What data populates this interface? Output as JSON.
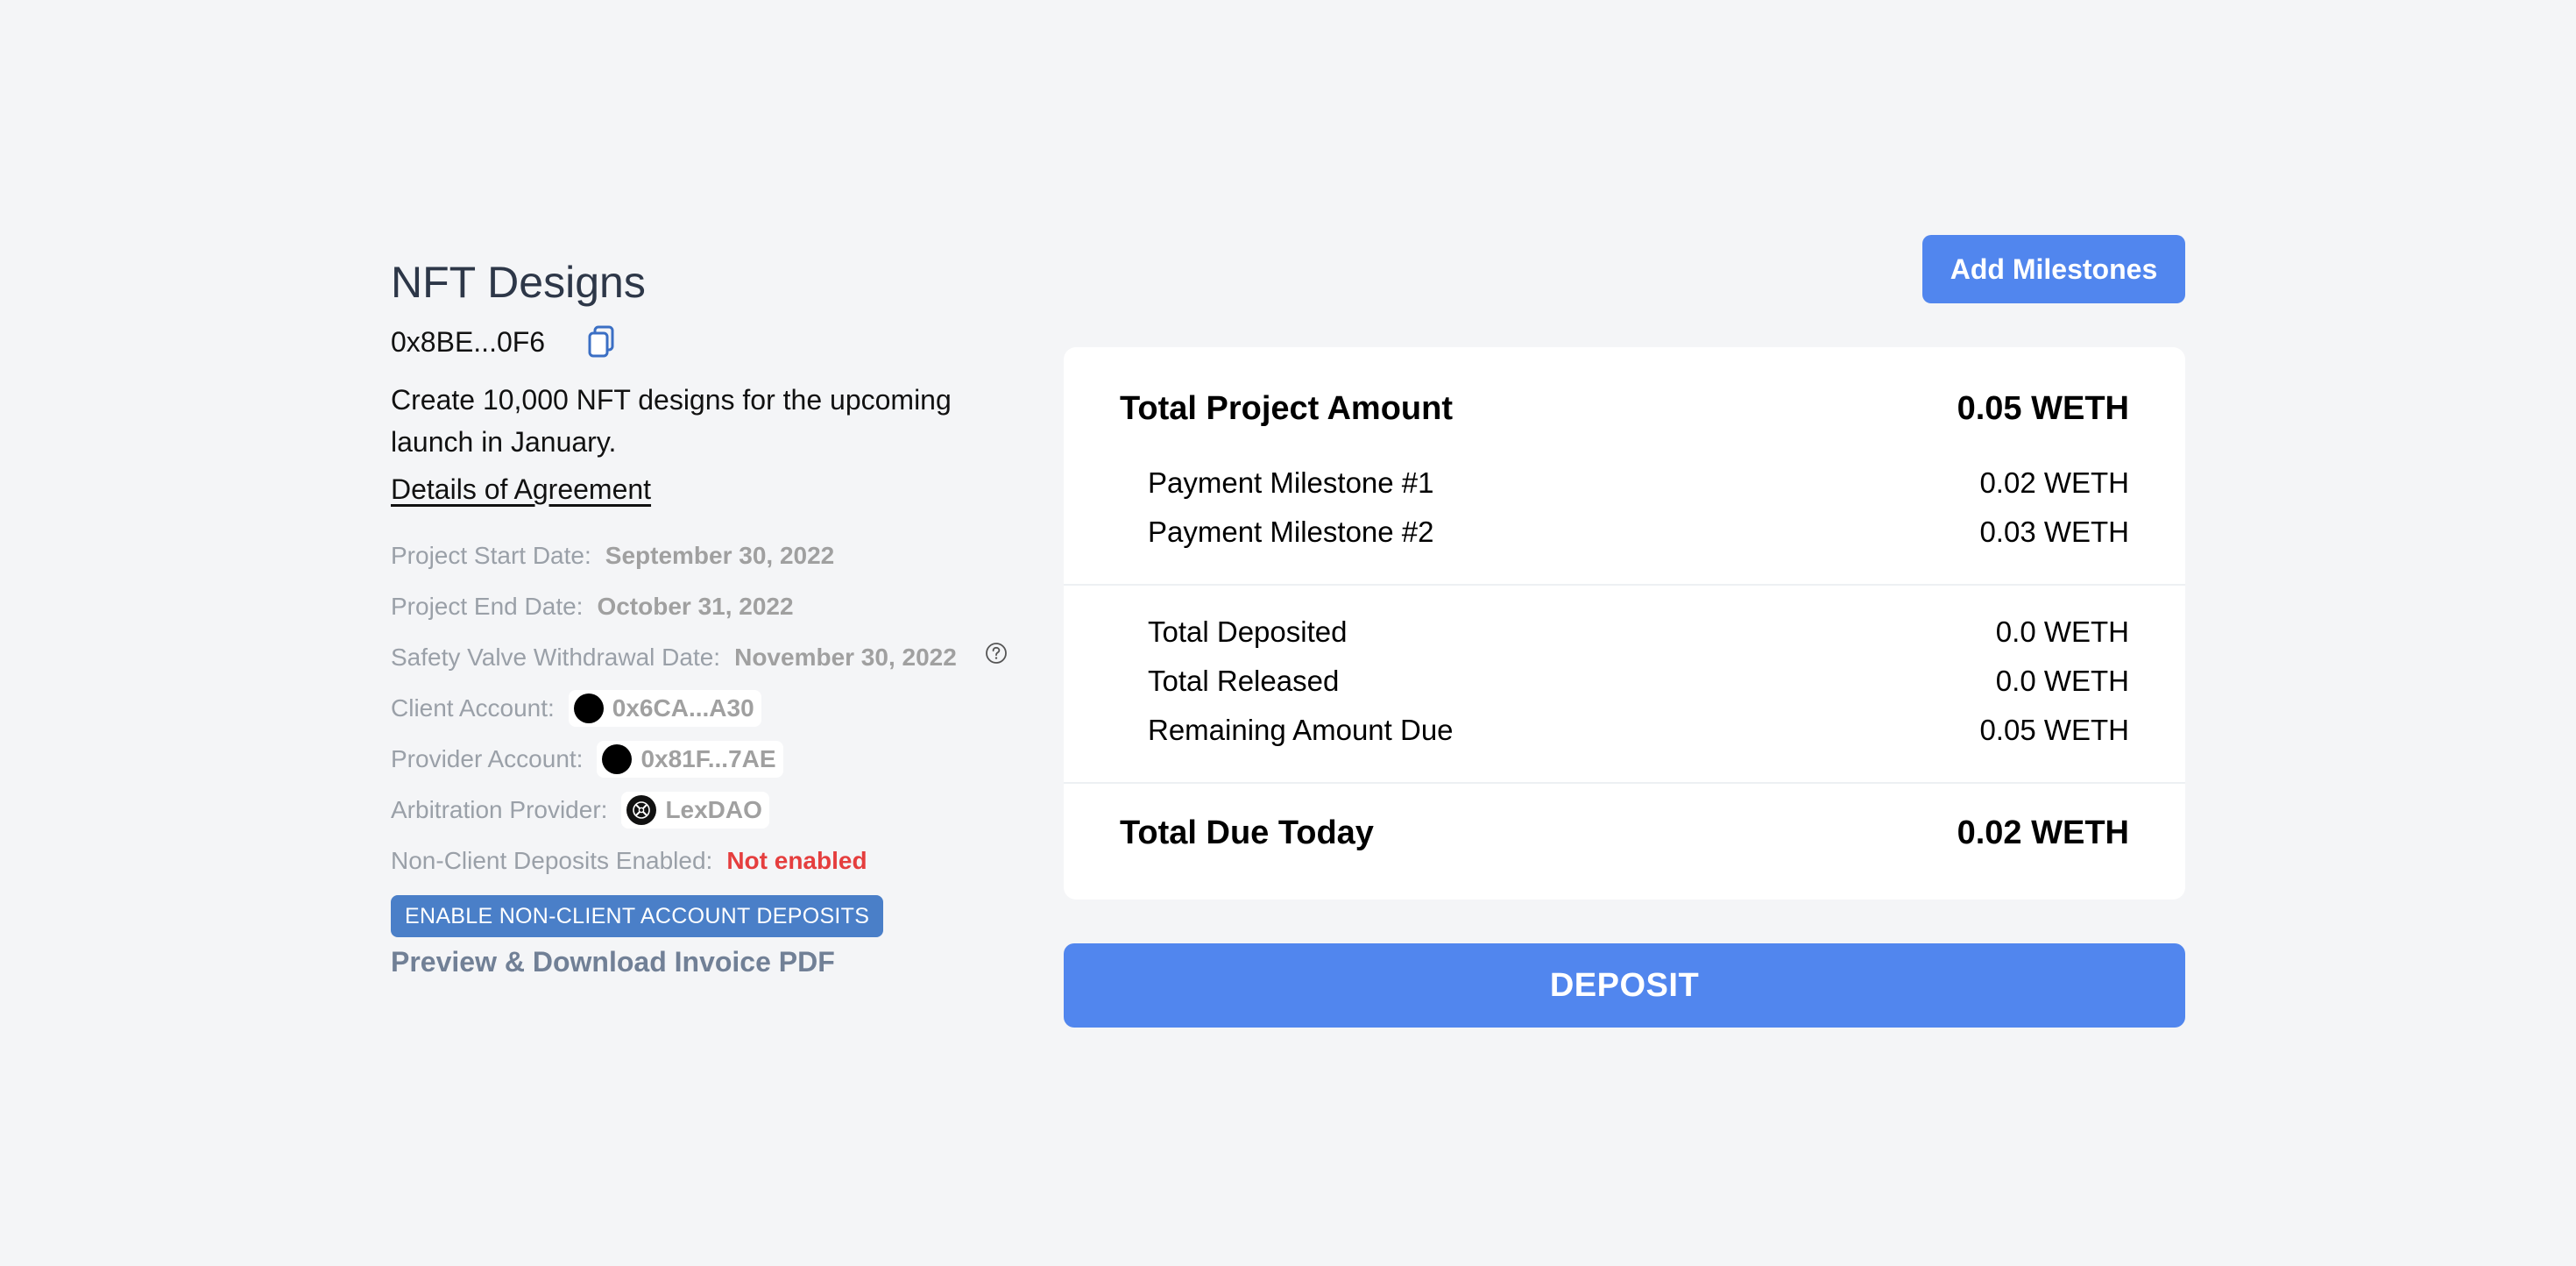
{
  "project": {
    "title": "NFT Designs",
    "address": "0x8BE...0F6",
    "description": "Create 10,000 NFT designs for the upcoming launch in January.",
    "agreement_link": "Details of Agreement"
  },
  "info": {
    "start_label": "Project Start Date:",
    "start_value": "September 30, 2022",
    "end_label": "Project End Date:",
    "end_value": "October 31, 2022",
    "safety_label": "Safety Valve Withdrawal Date:",
    "safety_value": "November 30, 2022",
    "client_label": "Client Account:",
    "client_value": "0x6CA...A30",
    "provider_label": "Provider Account:",
    "provider_value": "0x81F...7AE",
    "arbitration_label": "Arbitration Provider:",
    "arbitration_value": "LexDAO",
    "non_client_label": "Non-Client Deposits Enabled:",
    "non_client_value": "Not enabled"
  },
  "actions": {
    "enable_button": "ENABLE NON-CLIENT ACCOUNT DEPOSITS",
    "invoice_link": "Preview & Download Invoice PDF",
    "add_milestones": "Add Milestones",
    "deposit": "DEPOSIT"
  },
  "summary": {
    "total_project_label": "Total Project Amount",
    "total_project_value": "0.05 WETH",
    "milestones": [
      {
        "label": "Payment Milestone #1",
        "value": "0.02 WETH"
      },
      {
        "label": "Payment Milestone #2",
        "value": "0.03 WETH"
      }
    ],
    "deposited_label": "Total Deposited",
    "deposited_value": "0.0 WETH",
    "released_label": "Total Released",
    "released_value": "0.0 WETH",
    "remaining_label": "Remaining Amount Due",
    "remaining_value": "0.05 WETH",
    "due_today_label": "Total Due Today",
    "due_today_value": "0.02 WETH"
  },
  "colors": {
    "primary_button": "#5186ee",
    "enable_button": "#4a7fc8",
    "status_red": "#e53e3e",
    "background": "#f4f5f7"
  },
  "icons": {
    "copy": "copy-icon",
    "help": "question-circle-icon",
    "lexdao": "lexdao-logo-icon"
  }
}
